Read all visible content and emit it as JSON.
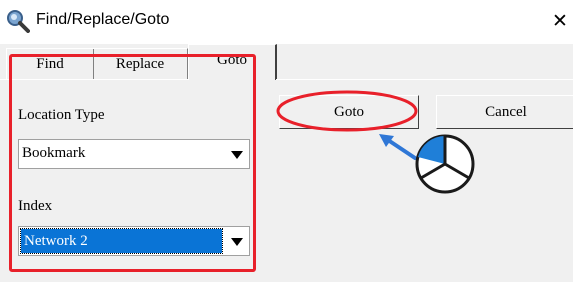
{
  "window": {
    "title": "Find/Replace/Goto",
    "close_glyph": "✕"
  },
  "tabs": [
    {
      "label": "Find",
      "active": false
    },
    {
      "label": "Replace",
      "active": false
    },
    {
      "label": "Goto",
      "active": true
    }
  ],
  "location": {
    "type_label": "Location Type",
    "type_value": "Bookmark",
    "index_label": "Index",
    "index_value": "Network 2"
  },
  "buttons": {
    "goto_label": "Goto",
    "cancel_label": "Cancel"
  },
  "annotation": {
    "highlight_color": "#e8202a",
    "arrow_color": "#2f77d6",
    "mouse_icon": "mouse-left-click-icon"
  }
}
